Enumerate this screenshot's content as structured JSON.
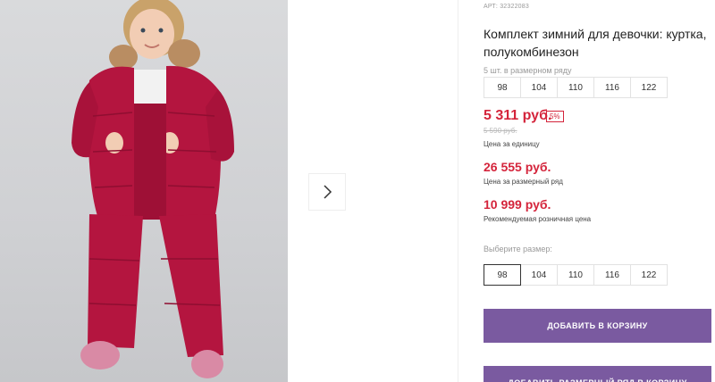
{
  "gallery": {
    "photo_alt": "",
    "next_icon": "chevron-right-icon"
  },
  "product": {
    "sku_label": "АРТ:",
    "sku_value": "32322083",
    "title": "Комплект зимний для девочки: куртка, полукомбинезон",
    "pack_hint": "5 шт. в размерном ряду",
    "pack_sizes": [
      "98",
      "104",
      "110",
      "116",
      "122"
    ],
    "price": "5 311 руб.",
    "discount": "5%",
    "old_price": "5 590 руб.",
    "unit_price_caption": "Цена за единицу",
    "pack_price": "26 555 руб.",
    "pack_price_caption": "Цена за размерный ряд",
    "rrp": "10 999 руб.",
    "rrp_caption": "Рекомендуемая розничная цена",
    "select_size_label": "Выберите размер:",
    "select_sizes": [
      "98",
      "104",
      "110",
      "116",
      "122"
    ],
    "selected_size": "98",
    "add_to_cart": "ДОБАВИТЬ В КОРЗИНУ",
    "add_pack_to_cart": "ДОБАВИТЬ РАЗМЕРНЫЙ РЯД В КОРЗИНУ"
  },
  "colors": {
    "accent": "#7a5aa0",
    "price_red": "#d4243b",
    "jacket": "#b4153f"
  }
}
